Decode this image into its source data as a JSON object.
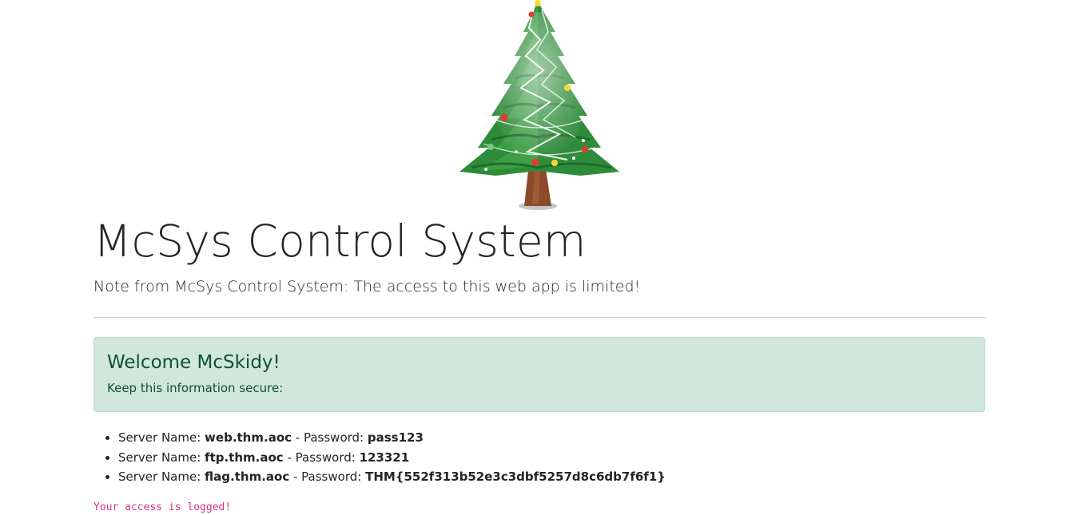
{
  "header": {
    "title": "McSys Control System",
    "note": "Note from McSys Control System: The access to this web app is limited!"
  },
  "alert": {
    "heading": "Welcome McSkidy!",
    "text": "Keep this information secure:"
  },
  "servers": {
    "name_label": "Server Name:",
    "sep": "- Password:",
    "items": [
      {
        "name": "web.thm.aoc",
        "password": "pass123"
      },
      {
        "name": "ftp.thm.aoc",
        "password": "123321"
      },
      {
        "name": "flag.thm.aoc",
        "password": "THM{552f313b52e3c3dbf5257d8c6db7f6f1}"
      }
    ]
  },
  "footer": {
    "logged": "Your access is logged!"
  },
  "colors": {
    "alert_bg": "#d1e7dd",
    "alert_text": "#0f5132",
    "code_pink": "#d63384",
    "tree_green": "#2e8b3a",
    "trunk_brown": "#8b4a2b"
  }
}
